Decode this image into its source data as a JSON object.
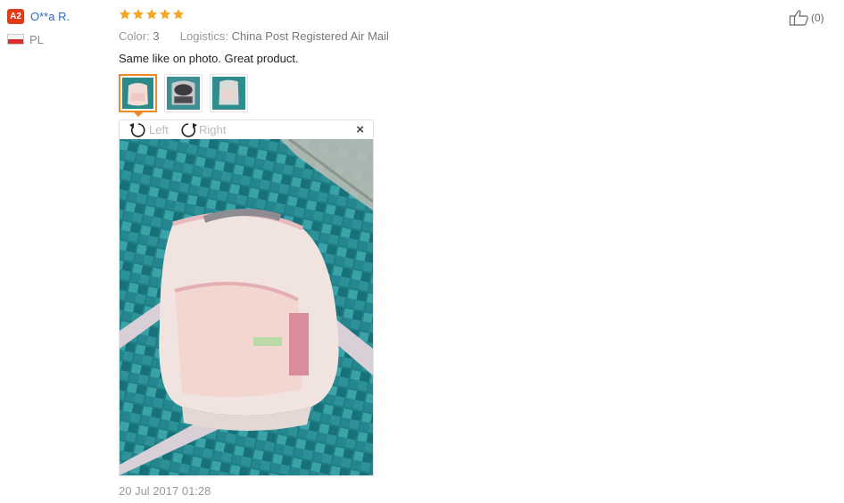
{
  "reviewer": {
    "badge": "A2",
    "name": "O**a R.",
    "country": "PL"
  },
  "review": {
    "rating": 5,
    "rating_max": 5,
    "color_label": "Color:",
    "color_value": "3",
    "logistics_label": "Logistics:",
    "logistics_value": "China Post Registered Air Mail",
    "text": "Same like on photo. Great product.",
    "date": "20 Jul 2017 01:28"
  },
  "helpful": {
    "count": "(0)"
  },
  "viewer": {
    "rotate_left_label": "Left",
    "rotate_right_label": "Right",
    "close_label": "×",
    "thumbnail_count": 3,
    "selected_thumbnail": 1
  },
  "colors": {
    "star": "#f5a623",
    "badge": "#e03c1c",
    "name_link": "#2c6bb8",
    "thumb_active": "#f08a24"
  }
}
